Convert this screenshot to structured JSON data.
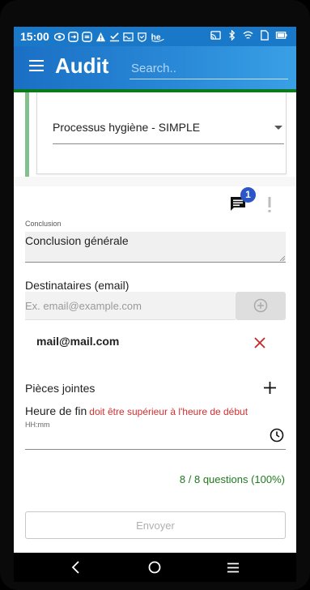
{
  "status_bar": {
    "time": "15:00"
  },
  "app_bar": {
    "title": "Audit",
    "search_placeholder": "Search.."
  },
  "process_select": {
    "selected_value": "Processus hygiène - SIMPLE"
  },
  "comments": {
    "count": "1"
  },
  "conclusion": {
    "label": "Conclusion",
    "value": "Conclusion générale"
  },
  "recipients": {
    "label": "Destinataires (email)",
    "placeholder": "Ex. email@example.com",
    "emails": [
      "mail@mail.com"
    ]
  },
  "attachments": {
    "label": "Pièces jointes"
  },
  "end_time": {
    "label": "Heure de fin",
    "warning": "doit être supérieur à l'heure de début",
    "placeholder": "HH:mm"
  },
  "progress": {
    "text": "8 / 8 questions (100%)"
  },
  "submit": {
    "label": "Envoyer"
  },
  "colors": {
    "primary": "#1a78c8",
    "accent_green": "#0a7a1a",
    "badge": "#2a56c6",
    "error": "#d32f2f",
    "progress_green": "#1f7a1f"
  }
}
